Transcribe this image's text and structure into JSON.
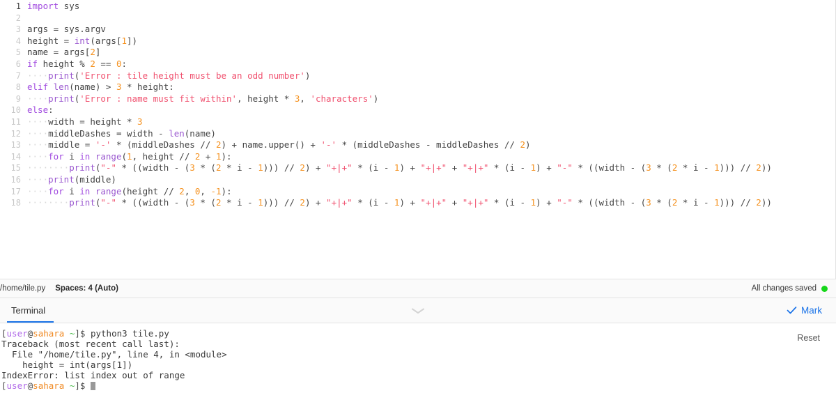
{
  "editor": {
    "lines": [
      {
        "n": "1",
        "current": true,
        "indent": 0,
        "tokens": [
          {
            "t": "import",
            "c": "kw"
          },
          {
            "t": " sys",
            "c": "pln"
          }
        ]
      },
      {
        "n": "2",
        "current": false,
        "indent": 0,
        "tokens": []
      },
      {
        "n": "3",
        "current": false,
        "indent": 0,
        "tokens": [
          {
            "t": "args = sys.argv",
            "c": "pln"
          }
        ]
      },
      {
        "n": "4",
        "current": false,
        "indent": 0,
        "tokens": [
          {
            "t": "height = ",
            "c": "pln"
          },
          {
            "t": "int",
            "c": "bi"
          },
          {
            "t": "(args[",
            "c": "pln"
          },
          {
            "t": "1",
            "c": "num"
          },
          {
            "t": "])",
            "c": "pln"
          }
        ]
      },
      {
        "n": "5",
        "current": false,
        "indent": 0,
        "tokens": [
          {
            "t": "name = args[",
            "c": "pln"
          },
          {
            "t": "2",
            "c": "num"
          },
          {
            "t": "]",
            "c": "pln"
          }
        ]
      },
      {
        "n": "6",
        "current": false,
        "indent": 0,
        "tokens": [
          {
            "t": "if",
            "c": "kw"
          },
          {
            "t": " height % ",
            "c": "pln"
          },
          {
            "t": "2",
            "c": "num"
          },
          {
            "t": " == ",
            "c": "pln"
          },
          {
            "t": "0",
            "c": "num"
          },
          {
            "t": ":",
            "c": "pln"
          }
        ]
      },
      {
        "n": "7",
        "current": false,
        "indent": 1,
        "tokens": [
          {
            "t": "print",
            "c": "bi"
          },
          {
            "t": "(",
            "c": "pln"
          },
          {
            "t": "'Error : tile height must be an odd number'",
            "c": "str"
          },
          {
            "t": ")",
            "c": "pln"
          }
        ]
      },
      {
        "n": "8",
        "current": false,
        "indent": 0,
        "tokens": [
          {
            "t": "elif",
            "c": "kw"
          },
          {
            "t": " ",
            "c": "pln"
          },
          {
            "t": "len",
            "c": "bi"
          },
          {
            "t": "(name) > ",
            "c": "pln"
          },
          {
            "t": "3",
            "c": "num"
          },
          {
            "t": " * height:",
            "c": "pln"
          }
        ]
      },
      {
        "n": "9",
        "current": false,
        "indent": 1,
        "tokens": [
          {
            "t": "print",
            "c": "bi"
          },
          {
            "t": "(",
            "c": "pln"
          },
          {
            "t": "'Error : name must fit within'",
            "c": "str"
          },
          {
            "t": ", height * ",
            "c": "pln"
          },
          {
            "t": "3",
            "c": "num"
          },
          {
            "t": ", ",
            "c": "pln"
          },
          {
            "t": "'characters'",
            "c": "str"
          },
          {
            "t": ")",
            "c": "pln"
          }
        ]
      },
      {
        "n": "10",
        "current": false,
        "indent": 0,
        "tokens": [
          {
            "t": "else",
            "c": "kw"
          },
          {
            "t": ":",
            "c": "pln"
          }
        ]
      },
      {
        "n": "11",
        "current": false,
        "indent": 1,
        "tokens": [
          {
            "t": "width = height * ",
            "c": "pln"
          },
          {
            "t": "3",
            "c": "num"
          }
        ]
      },
      {
        "n": "12",
        "current": false,
        "indent": 1,
        "tokens": [
          {
            "t": "middleDashes = width - ",
            "c": "pln"
          },
          {
            "t": "len",
            "c": "bi"
          },
          {
            "t": "(name)",
            "c": "pln"
          }
        ]
      },
      {
        "n": "13",
        "current": false,
        "indent": 1,
        "tokens": [
          {
            "t": "middle = ",
            "c": "pln"
          },
          {
            "t": "'-'",
            "c": "str"
          },
          {
            "t": " * (middleDashes // ",
            "c": "pln"
          },
          {
            "t": "2",
            "c": "num"
          },
          {
            "t": ") + name.upper() + ",
            "c": "pln"
          },
          {
            "t": "'-'",
            "c": "str"
          },
          {
            "t": " * (middleDashes - middleDashes // ",
            "c": "pln"
          },
          {
            "t": "2",
            "c": "num"
          },
          {
            "t": ")",
            "c": "pln"
          }
        ]
      },
      {
        "n": "14",
        "current": false,
        "indent": 1,
        "tokens": [
          {
            "t": "for",
            "c": "kw"
          },
          {
            "t": " i ",
            "c": "pln"
          },
          {
            "t": "in",
            "c": "kw"
          },
          {
            "t": " ",
            "c": "pln"
          },
          {
            "t": "range",
            "c": "bi"
          },
          {
            "t": "(",
            "c": "pln"
          },
          {
            "t": "1",
            "c": "num"
          },
          {
            "t": ", height // ",
            "c": "pln"
          },
          {
            "t": "2",
            "c": "num"
          },
          {
            "t": " + ",
            "c": "pln"
          },
          {
            "t": "1",
            "c": "num"
          },
          {
            "t": "):",
            "c": "pln"
          }
        ]
      },
      {
        "n": "15",
        "current": false,
        "indent": 2,
        "tokens": [
          {
            "t": "print",
            "c": "bi"
          },
          {
            "t": "(",
            "c": "pln"
          },
          {
            "t": "\"-\"",
            "c": "str"
          },
          {
            "t": " * ((width - (",
            "c": "pln"
          },
          {
            "t": "3",
            "c": "num"
          },
          {
            "t": " * (",
            "c": "pln"
          },
          {
            "t": "2",
            "c": "num"
          },
          {
            "t": " * i - ",
            "c": "pln"
          },
          {
            "t": "1",
            "c": "num"
          },
          {
            "t": "))) // ",
            "c": "pln"
          },
          {
            "t": "2",
            "c": "num"
          },
          {
            "t": ") + ",
            "c": "pln"
          },
          {
            "t": "\"+|+\"",
            "c": "str"
          },
          {
            "t": " * (i - ",
            "c": "pln"
          },
          {
            "t": "1",
            "c": "num"
          },
          {
            "t": ") + ",
            "c": "pln"
          },
          {
            "t": "\"+|+\"",
            "c": "str"
          },
          {
            "t": " + ",
            "c": "pln"
          },
          {
            "t": "\"+|+\"",
            "c": "str"
          },
          {
            "t": " * (i - ",
            "c": "pln"
          },
          {
            "t": "1",
            "c": "num"
          },
          {
            "t": ") + ",
            "c": "pln"
          },
          {
            "t": "\"-\"",
            "c": "str"
          },
          {
            "t": " * ((width - (",
            "c": "pln"
          },
          {
            "t": "3",
            "c": "num"
          },
          {
            "t": " * (",
            "c": "pln"
          },
          {
            "t": "2",
            "c": "num"
          },
          {
            "t": " * i - ",
            "c": "pln"
          },
          {
            "t": "1",
            "c": "num"
          },
          {
            "t": "))) // ",
            "c": "pln"
          },
          {
            "t": "2",
            "c": "num"
          },
          {
            "t": "))",
            "c": "pln"
          }
        ]
      },
      {
        "n": "16",
        "current": false,
        "indent": 1,
        "tokens": [
          {
            "t": "print",
            "c": "bi"
          },
          {
            "t": "(middle)",
            "c": "pln"
          }
        ]
      },
      {
        "n": "17",
        "current": false,
        "indent": 1,
        "tokens": [
          {
            "t": "for",
            "c": "kw"
          },
          {
            "t": " i ",
            "c": "pln"
          },
          {
            "t": "in",
            "c": "kw"
          },
          {
            "t": " ",
            "c": "pln"
          },
          {
            "t": "range",
            "c": "bi"
          },
          {
            "t": "(height // ",
            "c": "pln"
          },
          {
            "t": "2",
            "c": "num"
          },
          {
            "t": ", ",
            "c": "pln"
          },
          {
            "t": "0",
            "c": "num"
          },
          {
            "t": ", ",
            "c": "pln"
          },
          {
            "t": "-1",
            "c": "num"
          },
          {
            "t": "):",
            "c": "pln"
          }
        ]
      },
      {
        "n": "18",
        "current": false,
        "indent": 2,
        "tokens": [
          {
            "t": "print",
            "c": "bi"
          },
          {
            "t": "(",
            "c": "pln"
          },
          {
            "t": "\"-\"",
            "c": "str"
          },
          {
            "t": " * ((width - (",
            "c": "pln"
          },
          {
            "t": "3",
            "c": "num"
          },
          {
            "t": " * (",
            "c": "pln"
          },
          {
            "t": "2",
            "c": "num"
          },
          {
            "t": " * i - ",
            "c": "pln"
          },
          {
            "t": "1",
            "c": "num"
          },
          {
            "t": "))) // ",
            "c": "pln"
          },
          {
            "t": "2",
            "c": "num"
          },
          {
            "t": ") + ",
            "c": "pln"
          },
          {
            "t": "\"+|+\"",
            "c": "str"
          },
          {
            "t": " * (i - ",
            "c": "pln"
          },
          {
            "t": "1",
            "c": "num"
          },
          {
            "t": ") + ",
            "c": "pln"
          },
          {
            "t": "\"+|+\"",
            "c": "str"
          },
          {
            "t": " + ",
            "c": "pln"
          },
          {
            "t": "\"+|+\"",
            "c": "str"
          },
          {
            "t": " * (i - ",
            "c": "pln"
          },
          {
            "t": "1",
            "c": "num"
          },
          {
            "t": ") + ",
            "c": "pln"
          },
          {
            "t": "\"-\"",
            "c": "str"
          },
          {
            "t": " * ((width - (",
            "c": "pln"
          },
          {
            "t": "3",
            "c": "num"
          },
          {
            "t": " * (",
            "c": "pln"
          },
          {
            "t": "2",
            "c": "num"
          },
          {
            "t": " * i - ",
            "c": "pln"
          },
          {
            "t": "1",
            "c": "num"
          },
          {
            "t": "))) // ",
            "c": "pln"
          },
          {
            "t": "2",
            "c": "num"
          },
          {
            "t": "))",
            "c": "pln"
          }
        ]
      }
    ]
  },
  "status": {
    "file_path": "/home/tile.py",
    "spaces": "Spaces: 4 (Auto)",
    "save_state": "All changes saved",
    "save_dot_color": "#16d61a"
  },
  "terminal": {
    "tabs": [
      {
        "label": "Terminal",
        "active": true
      }
    ],
    "collapse_icon": "chevron-down-icon",
    "mark_label": "Mark",
    "mark_icon": "check-icon",
    "mark_color": "#1a73e8",
    "reset_label": "Reset",
    "prompt": {
      "open_bracket": "[",
      "user": "user",
      "at": "@",
      "host": "sahara",
      "space_tilde": " ~",
      "close": "]$ "
    },
    "output_lines": [
      {
        "type": "prompt",
        "command": "python3 tile.py"
      },
      {
        "type": "text",
        "text": "Traceback (most recent call last):"
      },
      {
        "type": "text",
        "text": "  File \"/home/tile.py\", line 4, in <module>"
      },
      {
        "type": "text",
        "text": "    height = int(args[1])"
      },
      {
        "type": "text",
        "text": "IndexError: list index out of range"
      },
      {
        "type": "prompt",
        "command": "",
        "cursor": true
      }
    ]
  }
}
